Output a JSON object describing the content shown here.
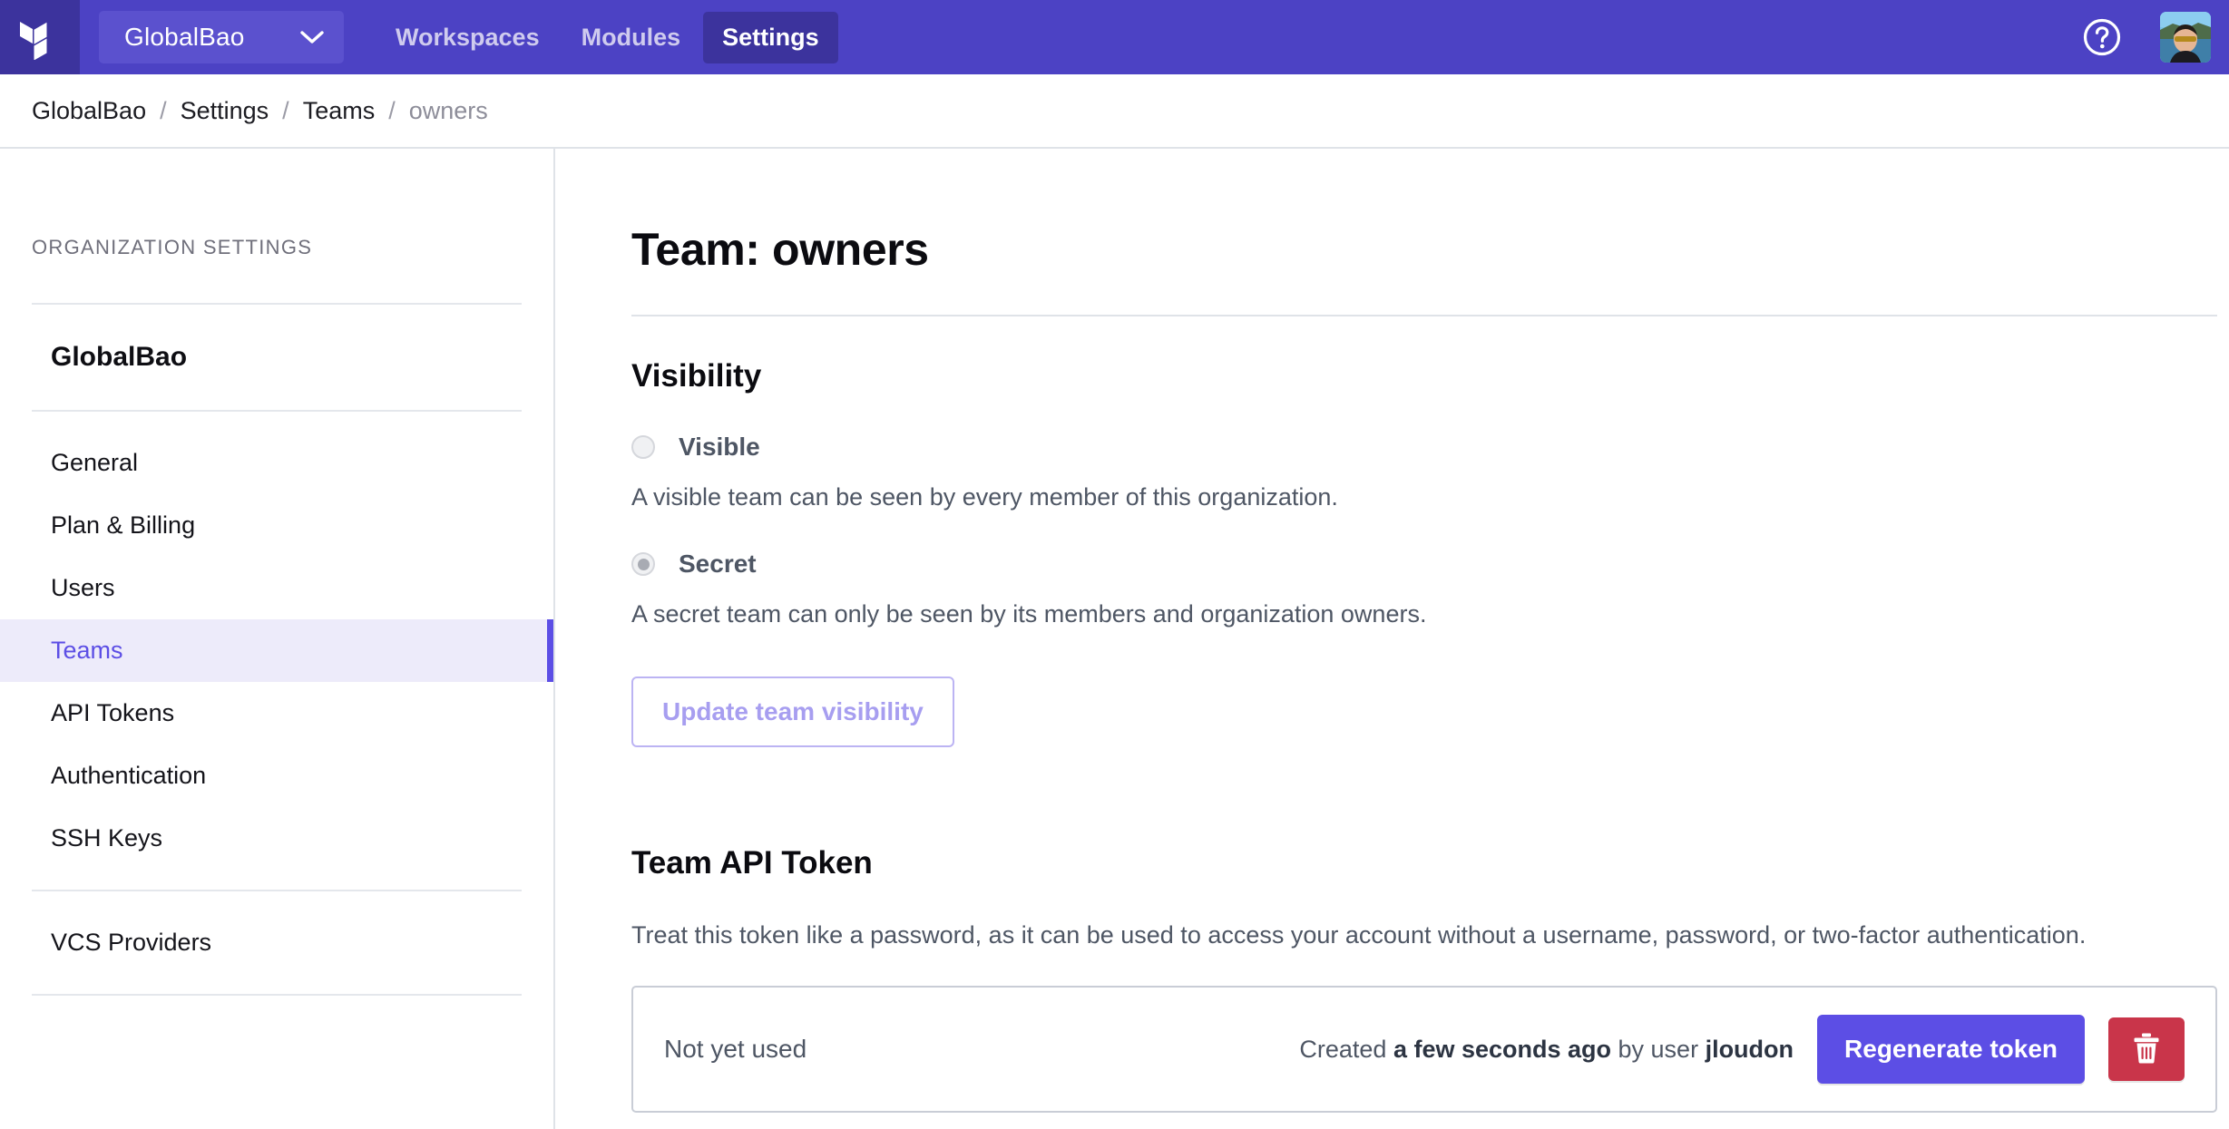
{
  "topnav": {
    "logo_icon": "terraform-logo-icon",
    "org_switcher": {
      "org_name": "GlobalBao",
      "chevron_icon": "chevron-down-icon"
    },
    "tabs": [
      {
        "label": "Workspaces",
        "active": false
      },
      {
        "label": "Modules",
        "active": false
      },
      {
        "label": "Settings",
        "active": true
      }
    ],
    "help_icon": "question-circle-icon",
    "avatar_alt": "user-avatar",
    "colors": {
      "bar_bg": "#4c42c4",
      "logo_bg": "#3c339d",
      "active_tab_bg": "#3c339d",
      "switcher_bg": "#5b51ce"
    }
  },
  "breadcrumb": {
    "separator": "/",
    "items": [
      {
        "label": "GlobalBao",
        "current": false
      },
      {
        "label": "Settings",
        "current": false
      },
      {
        "label": "Teams",
        "current": false
      },
      {
        "label": "owners",
        "current": true
      }
    ]
  },
  "sidebar": {
    "heading": "ORGANIZATION SETTINGS",
    "org_name": "GlobalBao",
    "items": [
      {
        "label": "General",
        "active": false
      },
      {
        "label": "Plan & Billing",
        "active": false
      },
      {
        "label": "Users",
        "active": false
      },
      {
        "label": "Teams",
        "active": true
      },
      {
        "label": "API Tokens",
        "active": false
      },
      {
        "label": "Authentication",
        "active": false
      },
      {
        "label": "SSH Keys",
        "active": false
      }
    ],
    "items_secondary": [
      {
        "label": "VCS Providers",
        "active": false
      }
    ],
    "accent_color": "#5c4ee5",
    "active_bg": "#edebfa"
  },
  "main": {
    "page_title": "Team: owners",
    "visibility": {
      "section_title": "Visibility",
      "options": [
        {
          "label": "Visible",
          "selected": false,
          "description": "A visible team can be seen by every member of this organization."
        },
        {
          "label": "Secret",
          "selected": true,
          "description": "A secret team can only be seen by its members and organization owners."
        }
      ],
      "update_button": "Update team visibility"
    },
    "api_token": {
      "section_title": "Team API Token",
      "description": "Treat this token like a password, as it can be used to access your account without a username, password, or two-factor authentication.",
      "status": "Not yet used",
      "created_prefix": "Created ",
      "created_when": "a few seconds ago",
      "created_by_prefix": " by user ",
      "created_by_user": "jloudon",
      "regenerate_button": "Regenerate token",
      "delete_icon": "trash-icon",
      "regenerate_color": "#5c4ee5",
      "delete_color": "#c9354a"
    }
  }
}
